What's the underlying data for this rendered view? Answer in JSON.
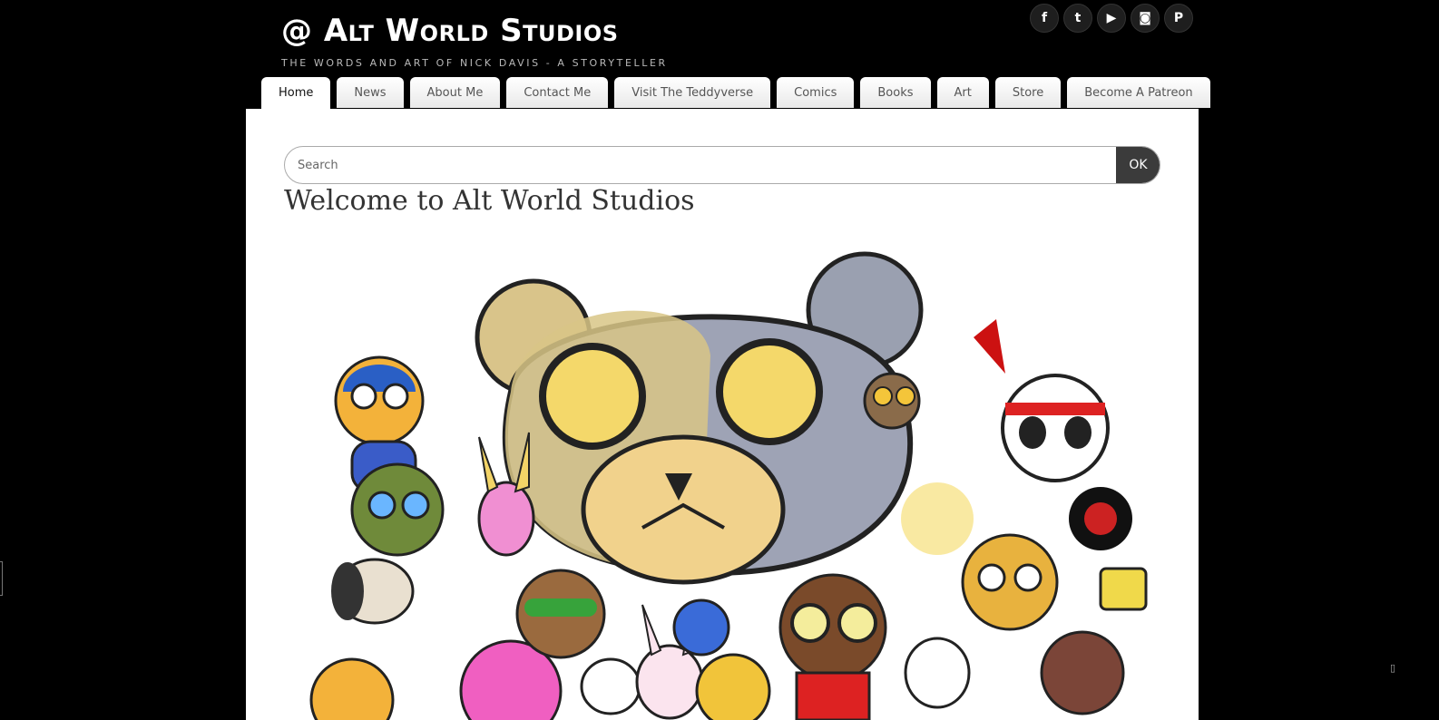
{
  "site": {
    "title": "@ Alt World Studios",
    "tagline": "THE WORDS AND ART OF NICK DAVIS - A STORYTELLER"
  },
  "social": [
    {
      "icon": "facebook-icon",
      "glyph": "f"
    },
    {
      "icon": "twitter-icon",
      "glyph": "t"
    },
    {
      "icon": "youtube-icon",
      "glyph": "▶"
    },
    {
      "icon": "instagram-icon",
      "glyph": "◙"
    },
    {
      "icon": "patreon-icon",
      "glyph": "P"
    }
  ],
  "nav": {
    "items": [
      {
        "label": "Home",
        "active": true
      },
      {
        "label": "News"
      },
      {
        "label": "About Me"
      },
      {
        "label": "Contact Me"
      },
      {
        "label": "Visit The Teddyverse"
      },
      {
        "label": "Comics"
      },
      {
        "label": "Books"
      },
      {
        "label": "Art"
      },
      {
        "label": "Store"
      },
      {
        "label": "Become A Patreon"
      }
    ]
  },
  "search": {
    "placeholder": "Search",
    "button_label": "OK"
  },
  "page": {
    "title": "Welcome to Alt World Studios"
  },
  "colors": {
    "background": "#000000",
    "content_bg": "#ffffff",
    "button_dark": "#3b3b3b"
  }
}
